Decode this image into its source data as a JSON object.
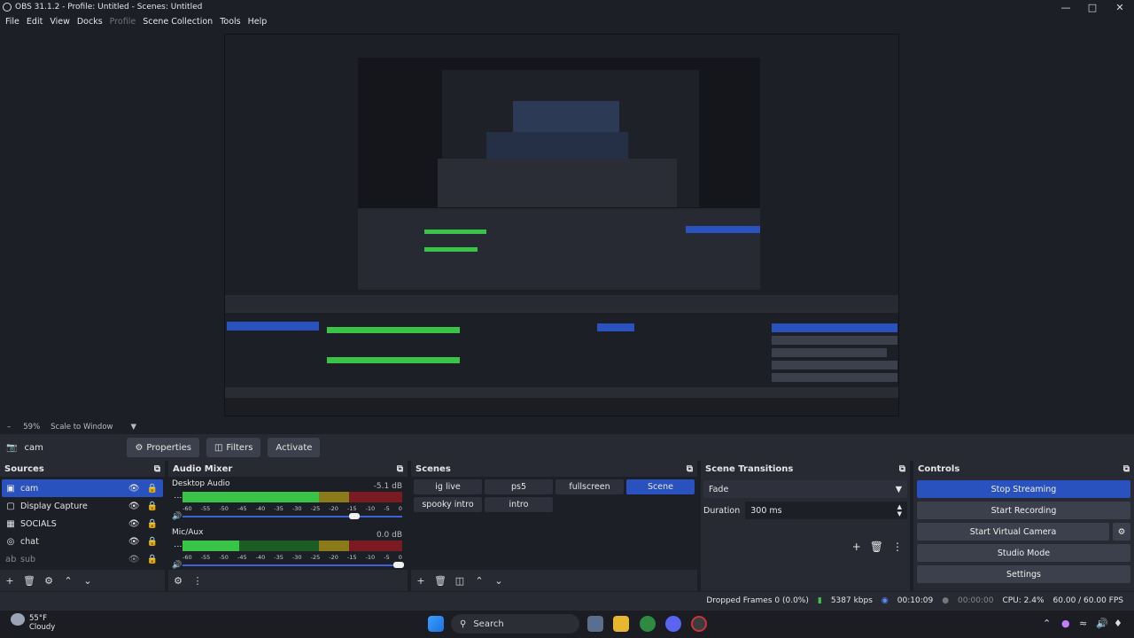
{
  "window": {
    "title": "OBS 31.1.2 - Profile: Untitled - Scenes: Untitled"
  },
  "menu": [
    "File",
    "Edit",
    "View",
    "Docks",
    "Profile",
    "Scene Collection",
    "Tools",
    "Help"
  ],
  "scale": {
    "zoom": "59%",
    "mode": "Scale to Window"
  },
  "context": {
    "source": "cam",
    "properties": "Properties",
    "filters": "Filters",
    "activate": "Activate"
  },
  "sources": {
    "title": "Sources",
    "items": [
      {
        "name": "cam",
        "icon": "camera-icon"
      },
      {
        "name": "Display Capture",
        "icon": "monitor-icon"
      },
      {
        "name": "SOCIALS",
        "icon": "image-icon"
      },
      {
        "name": "chat",
        "icon": "globe-icon"
      },
      {
        "name": "sub",
        "icon": "text-icon"
      }
    ]
  },
  "mixer": {
    "title": "Audio Mixer",
    "channels": [
      {
        "name": "Desktop Audio",
        "db": "-5.1 dB"
      },
      {
        "name": "Mic/Aux",
        "db": "0.0 dB"
      }
    ],
    "ticks": [
      "-60",
      "-55",
      "-50",
      "-45",
      "-40",
      "-35",
      "-30",
      "-25",
      "-20",
      "-15",
      "-10",
      "-5",
      "0"
    ]
  },
  "scenes": {
    "title": "Scenes",
    "items": [
      "ig live",
      "ps5",
      "fullscreen",
      "Scene",
      "spooky intro",
      "intro"
    ],
    "active": "Scene"
  },
  "transitions": {
    "title": "Scene Transitions",
    "type": "Fade",
    "duration_label": "Duration",
    "duration": "300 ms"
  },
  "controls": {
    "title": "Controls",
    "stop_streaming": "Stop Streaming",
    "start_recording": "Start Recording",
    "start_virtual_camera": "Start Virtual Camera",
    "studio_mode": "Studio Mode",
    "settings": "Settings"
  },
  "status": {
    "dropped": "Dropped Frames 0 (0.0%)",
    "bitrate": "5387 kbps",
    "live_time": "00:10:09",
    "rec_time": "00:00:00",
    "cpu": "CPU: 2.4%",
    "fps": "60.00 / 60.00 FPS"
  },
  "taskbar": {
    "weather_temp": "55°F",
    "weather_desc": "Cloudy",
    "search": "Search"
  },
  "colors": {
    "accent": "#2a52be",
    "panel": "#272a33",
    "bg": "#1d1f26"
  }
}
